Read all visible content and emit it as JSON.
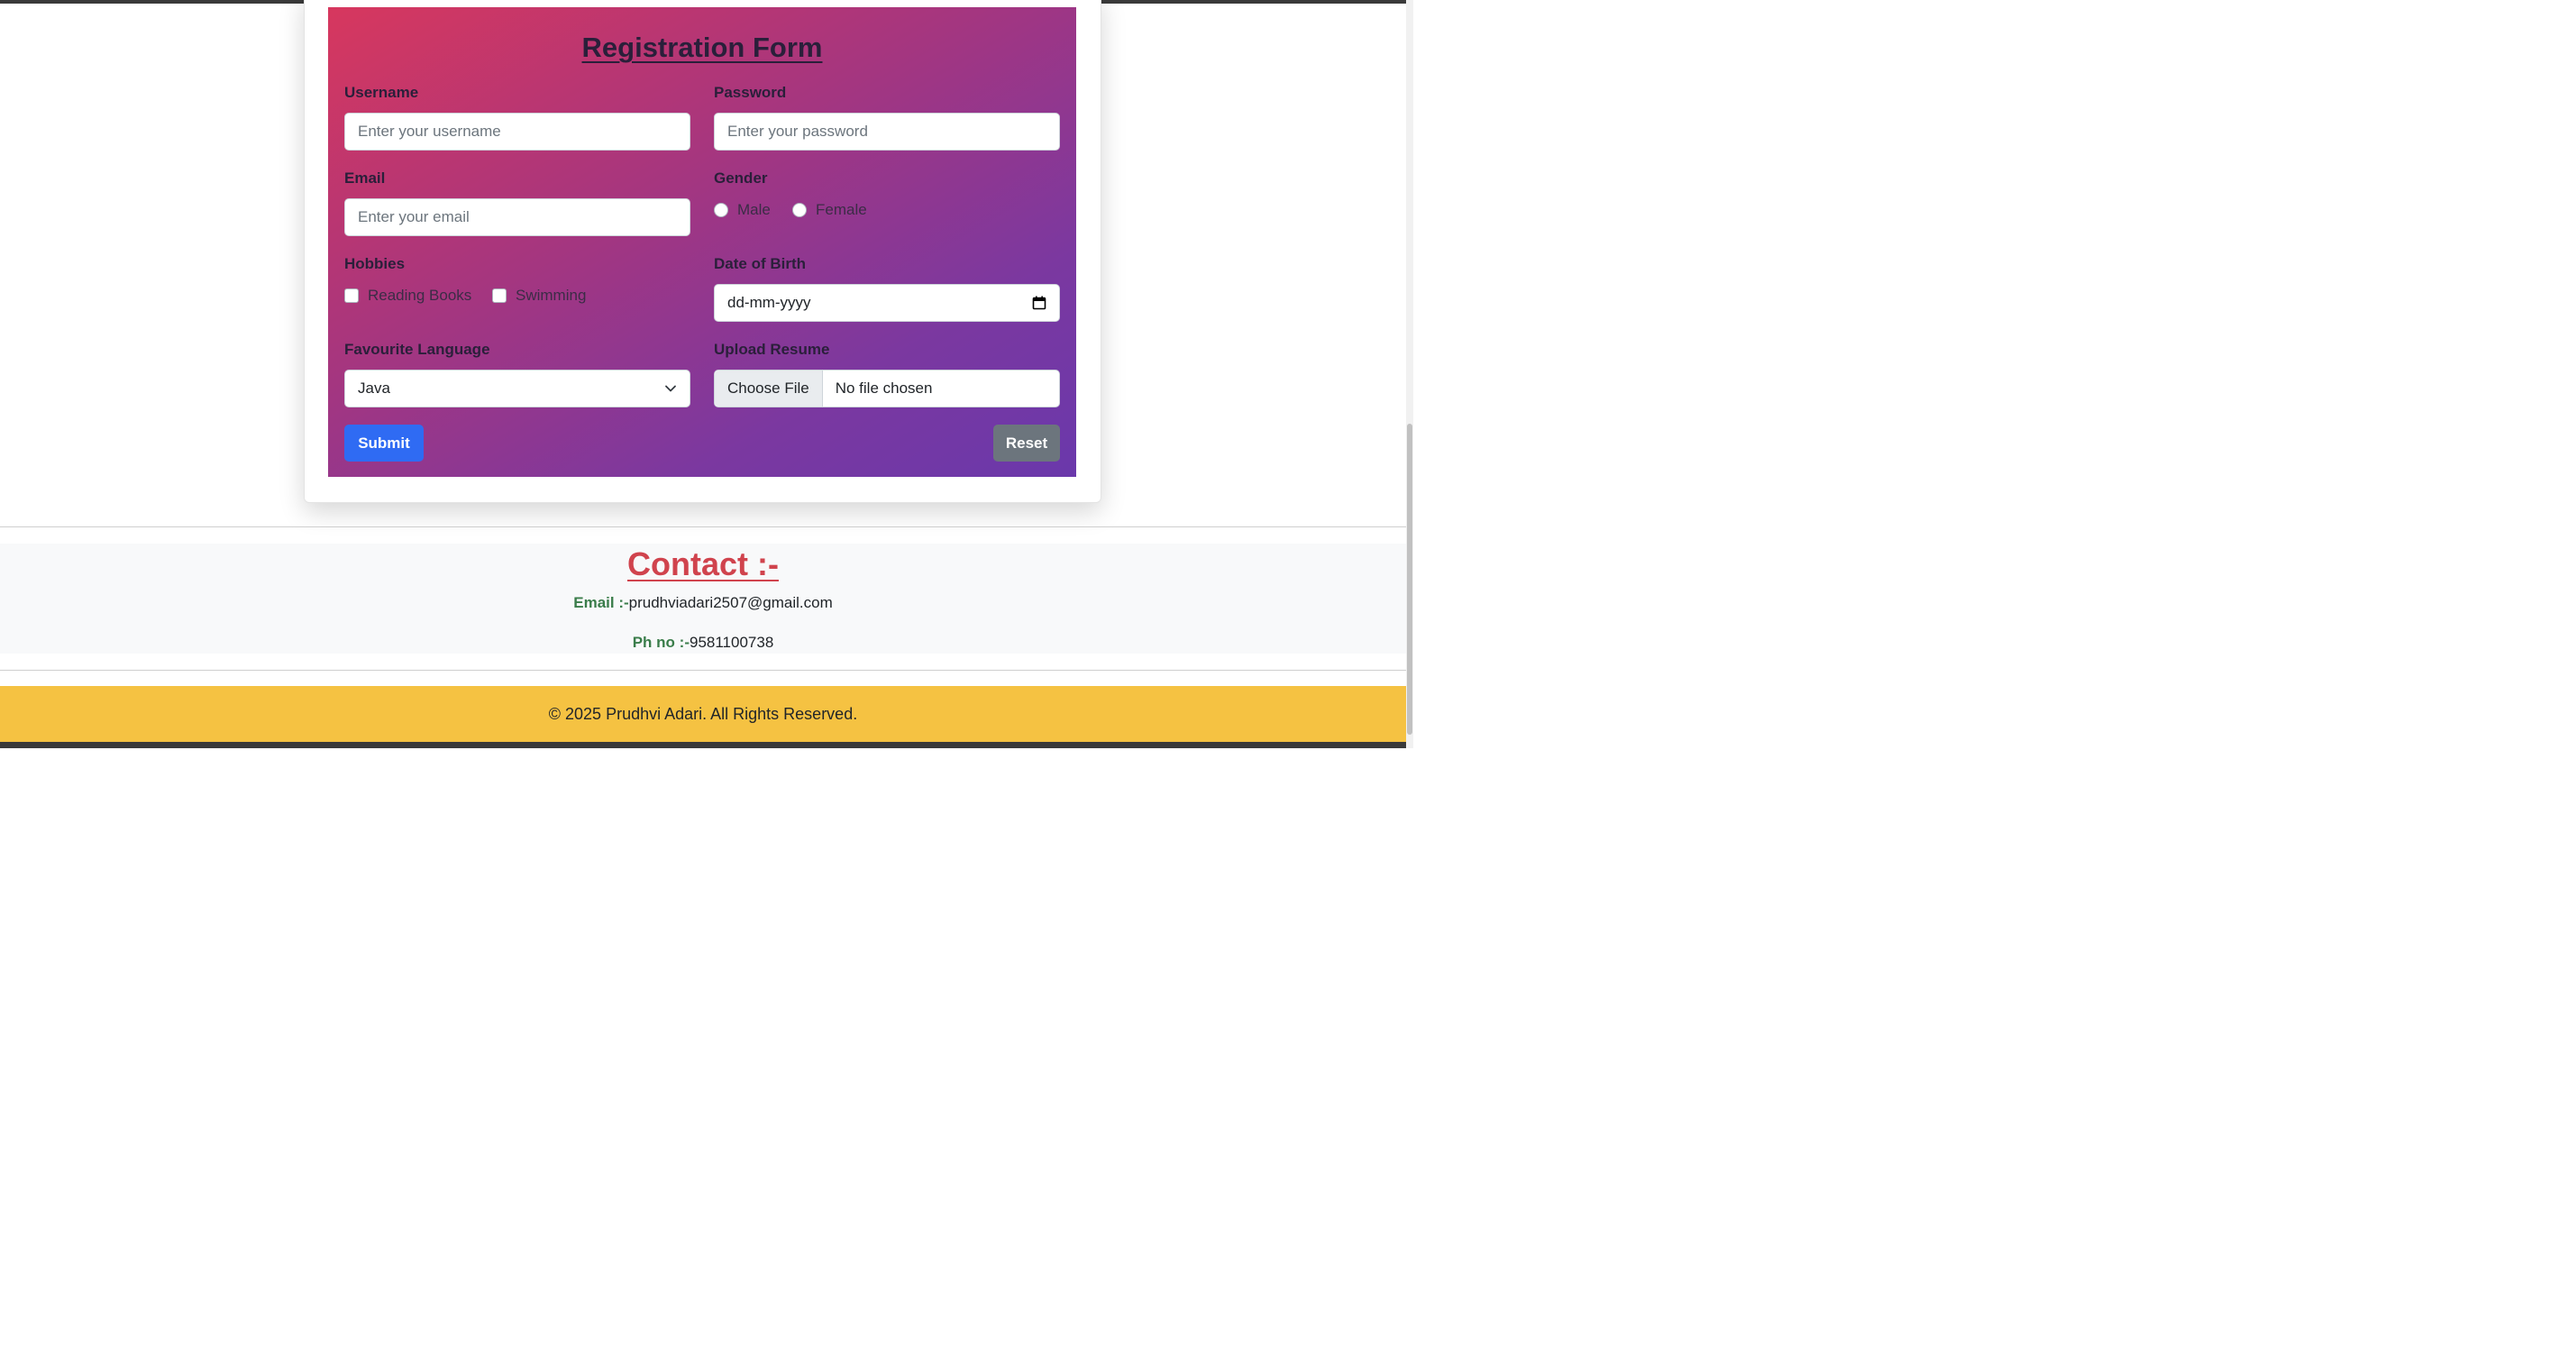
{
  "form": {
    "title": "Registration Form",
    "username": {
      "label": "Username",
      "placeholder": "Enter your username",
      "value": ""
    },
    "password": {
      "label": "Password",
      "placeholder": "Enter your password",
      "value": ""
    },
    "email": {
      "label": "Email",
      "placeholder": "Enter your email",
      "value": ""
    },
    "gender": {
      "label": "Gender",
      "options": [
        "Male",
        "Female"
      ],
      "selected": null
    },
    "hobbies": {
      "label": "Hobbies",
      "options": [
        "Reading Books",
        "Swimming"
      ],
      "checked": []
    },
    "dob": {
      "label": "Date of Birth",
      "placeholder": "dd-mm-yyyy"
    },
    "language": {
      "label": "Favourite Language",
      "selected": "Java"
    },
    "resume": {
      "label": "Upload Resume",
      "button": "Choose File",
      "status": "No file chosen"
    },
    "submit_label": "Submit",
    "reset_label": "Reset"
  },
  "contact": {
    "title": "Contact :-",
    "email_label": "Email :-",
    "email_value": "prudhviadari2507@gmail.com",
    "phone_label": "Ph no :-",
    "phone_value": "9581100738"
  },
  "footer": {
    "text": "© 2025 Prudhvi Adari. All Rights Reserved."
  },
  "colors": {
    "gradient_start": "#d7375e",
    "gradient_end": "#6a38ab",
    "submit": "#2f6bf3",
    "reset": "#6c757d",
    "contact_title": "#d0434d",
    "contact_label": "#3a7d4a",
    "footer_bg": "#f5c242"
  },
  "icons": {
    "calendar": "calendar-icon",
    "dropdown": "chevron-down-icon"
  }
}
